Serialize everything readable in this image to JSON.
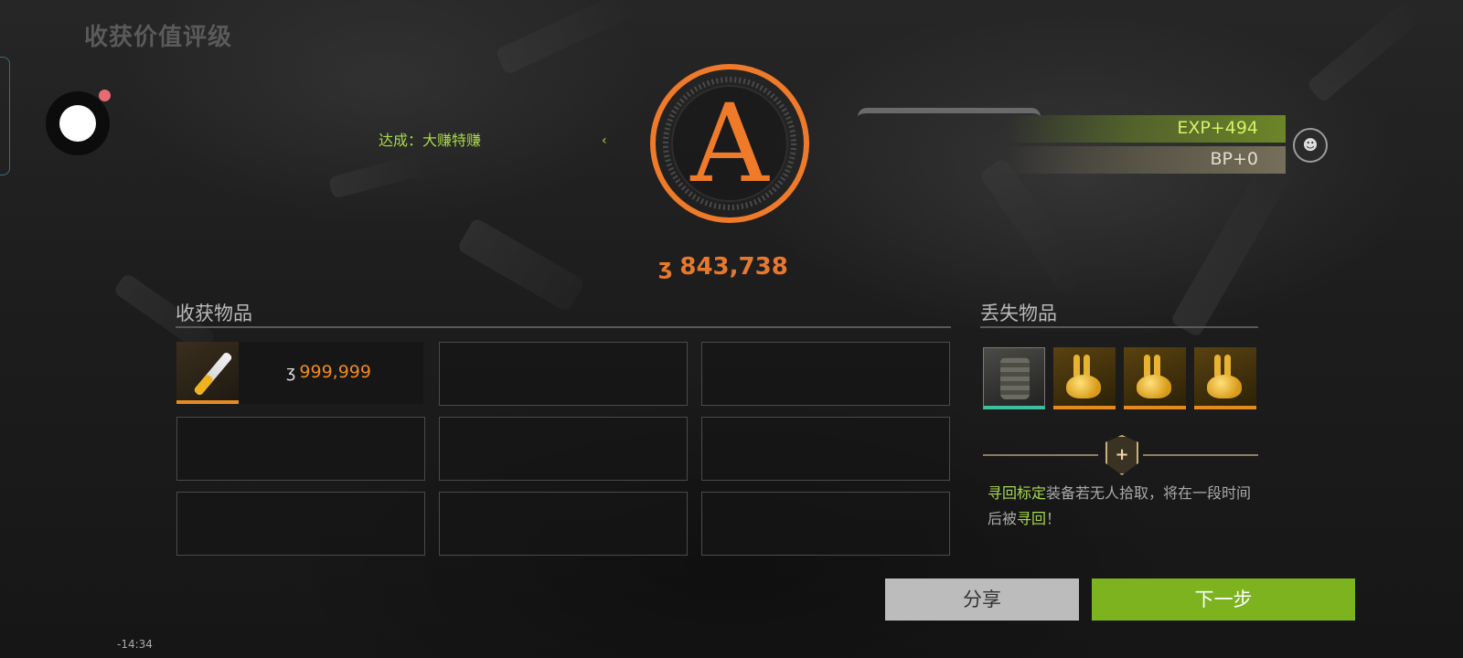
{
  "screen_title": "收获价值评级",
  "achievement": {
    "prefix": "达成：",
    "name": "大赚特赚"
  },
  "grade": {
    "letter": "A",
    "color": "#ee7a2a"
  },
  "total_value": {
    "currency_icon": "coin-icon",
    "currency_symbol": "ʒ",
    "amount": "843,738"
  },
  "rewards": {
    "exp": "EXP+494",
    "bp": "BP+0"
  },
  "harvest": {
    "title": "收获物品",
    "items": [
      {
        "icon": "syringe-icon",
        "currency_symbol": "ʒ",
        "price": "999,999"
      }
    ]
  },
  "lost": {
    "title": "丢失物品",
    "items": [
      {
        "icon": "backpack-icon"
      },
      {
        "icon": "golden-rabbit-icon"
      },
      {
        "icon": "golden-rabbit-icon"
      },
      {
        "icon": "golden-rabbit-icon"
      }
    ]
  },
  "retrieve": {
    "hl1": "寻回标定",
    "text1": "装备若无人拾取，将在一段时间后被",
    "hl2": "寻回",
    "text2": "！"
  },
  "buttons": {
    "share": "分享",
    "next": "下一步"
  },
  "hud_time": "-14:34",
  "colors": {
    "accent_green": "#a8d94a",
    "accent_orange": "#e8792c",
    "next_button": "#7cb31e"
  }
}
